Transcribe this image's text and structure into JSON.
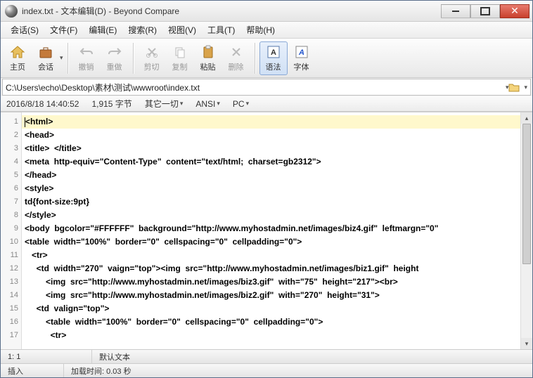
{
  "title": "index.txt - 文本编辑(D) - Beyond Compare",
  "menu": [
    "会话(S)",
    "文件(F)",
    "编辑(E)",
    "搜索(R)",
    "视图(V)",
    "工具(T)",
    "帮助(H)"
  ],
  "toolbar": {
    "home": "主页",
    "session": "会话",
    "undo": "撤销",
    "redo": "重做",
    "cut": "剪切",
    "copy": "复制",
    "paste": "粘贴",
    "delete": "删除",
    "syntax": "语法",
    "font": "字体"
  },
  "path": "C:\\Users\\echo\\Desktop\\素材\\测试\\wwwroot\\index.txt",
  "info": {
    "timestamp": "2016/8/18 14:40:52",
    "size": "1,915 字节",
    "filter": "其它一切",
    "encoding": "ANSI",
    "platform": "PC"
  },
  "code": [
    "<html>",
    "<head>",
    "<title>  </title>",
    "<meta  http-equiv=\"Content-Type\"  content=\"text/html;  charset=gb2312\">",
    "</head>",
    "<style>",
    "td{font-size:9pt}",
    "</style>",
    "<body  bgcolor=\"#FFFFFF\"  background=\"http://www.myhostadmin.net/images/biz4.gif\"  leftmargn=\"0\"",
    "<table  width=\"100%\"  border=\"0\"  cellspacing=\"0\"  cellpadding=\"0\">",
    "   <tr>",
    "     <td  width=\"270\"  vaign=\"top\"><img  src=\"http://www.myhostadmin.net/images/biz1.gif\"  height",
    "         <img  src=\"http://www.myhostadmin.net/images/biz3.gif\"  with=\"75\"  height=\"217\"><br>",
    "         <img  src=\"http://www.myhostadmin.net/images/biz2.gif\"  with=\"270\"  height=\"31\">",
    "     <td  valign=\"top\">",
    "         <table  width=\"100%\"  border=\"0\"  cellspacing=\"0\"  cellpadding=\"0\">",
    "           <tr>"
  ],
  "status1": {
    "pos": "1: 1",
    "mode": "默认文本"
  },
  "status2": {
    "insert": "插入",
    "load": "加载时间: 0.03 秒"
  }
}
